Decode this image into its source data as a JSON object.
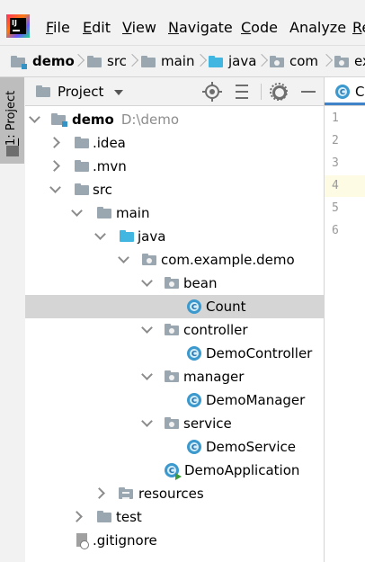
{
  "menu": {
    "items": [
      {
        "label": "File",
        "mnemonic": "F",
        "rest": "ile"
      },
      {
        "label": "Edit",
        "mnemonic": "E",
        "rest": "dit"
      },
      {
        "label": "View",
        "mnemonic": "V",
        "rest": "iew"
      },
      {
        "label": "Navigate",
        "mnemonic": "N",
        "rest": "avigate"
      },
      {
        "label": "Code",
        "mnemonic": "C",
        "rest": "ode"
      },
      {
        "label": "Analyze",
        "mnemonic": "",
        "rest": "Analyze"
      },
      {
        "label": "Re",
        "mnemonic": "R",
        "rest": "e"
      }
    ]
  },
  "breadcrumb": [
    "demo",
    "src",
    "main",
    "java",
    "com",
    "ex"
  ],
  "toolwindow": {
    "tab_number": "1",
    "tab_label": ": Project"
  },
  "panel": {
    "title": "Project"
  },
  "tree": [
    {
      "label": "demo",
      "path": "D:\\demo",
      "icon": "module-folder-icon",
      "arrow": "open"
    },
    {
      "label": ".idea",
      "icon": "folder-icon",
      "arrow": "closed"
    },
    {
      "label": ".mvn",
      "icon": "folder-icon",
      "arrow": "closed"
    },
    {
      "label": "src",
      "icon": "folder-icon",
      "arrow": "open"
    },
    {
      "label": "main",
      "icon": "folder-icon",
      "arrow": "open"
    },
    {
      "label": "java",
      "icon": "source-folder-icon",
      "arrow": "open"
    },
    {
      "label": "com.example.demo",
      "icon": "package-icon",
      "arrow": "open"
    },
    {
      "label": "bean",
      "icon": "package-icon",
      "arrow": "open"
    },
    {
      "label": "Count",
      "icon": "class-icon",
      "arrow": "none",
      "selected": true
    },
    {
      "label": "controller",
      "icon": "package-icon",
      "arrow": "open"
    },
    {
      "label": "DemoController",
      "icon": "class-icon",
      "arrow": "none"
    },
    {
      "label": "manager",
      "icon": "package-icon",
      "arrow": "open"
    },
    {
      "label": "DemoManager",
      "icon": "class-icon",
      "arrow": "none"
    },
    {
      "label": "service",
      "icon": "package-icon",
      "arrow": "open"
    },
    {
      "label": "DemoService",
      "icon": "class-icon",
      "arrow": "none"
    },
    {
      "label": "DemoApplication",
      "icon": "spring-class-icon",
      "arrow": "none"
    },
    {
      "label": "resources",
      "icon": "resources-folder-icon",
      "arrow": "closed"
    },
    {
      "label": "test",
      "icon": "folder-icon",
      "arrow": "closed"
    },
    {
      "label": ".gitignore",
      "icon": "ignored-file-icon",
      "arrow": "none"
    }
  ],
  "editor": {
    "tab_label": "C",
    "line_numbers": [
      "1",
      "2",
      "3",
      "4",
      "5",
      "6"
    ],
    "current_line": "4"
  },
  "colors": {
    "class_icon": "#3c99ce",
    "source_folder": "#40b6e0",
    "selection": "#d5d5d5",
    "tab_underline": "#4083c9"
  }
}
